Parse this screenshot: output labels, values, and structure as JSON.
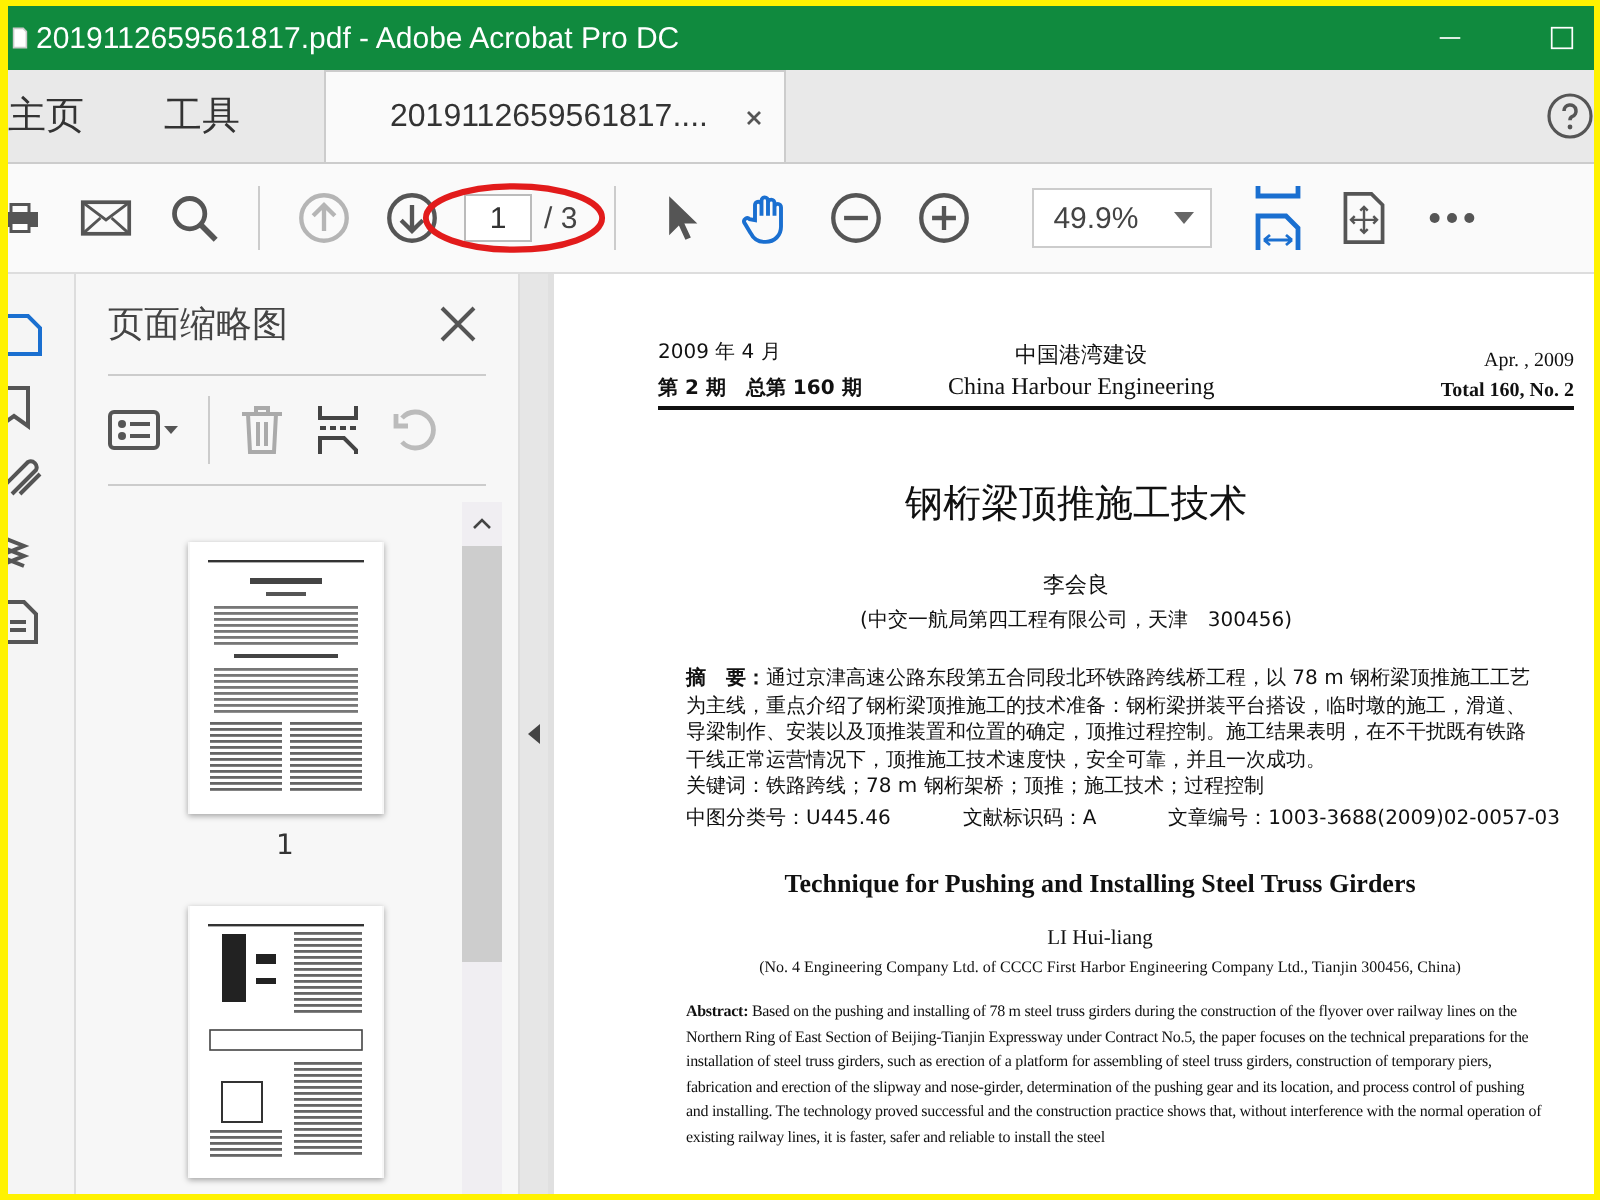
{
  "window": {
    "title": "2019112659561817.pdf - Adobe Acrobat Pro DC"
  },
  "nav_tabs": [
    {
      "label": "主页",
      "selected": false
    },
    {
      "label": "工具",
      "selected": false
    },
    {
      "label": "2019112659561817....",
      "selected": true
    }
  ],
  "toolbar": {
    "prev_page": {
      "disabled": true
    },
    "next_page": {
      "disabled": false
    },
    "page_field": {
      "value": "1",
      "total": "/ 3"
    },
    "zoom_field": {
      "value": "49.9%"
    }
  },
  "side_rail": [
    {
      "selected": true
    },
    {
      "selected": false
    },
    {
      "selected": false
    },
    {
      "selected": false
    },
    {
      "selected": false
    }
  ],
  "thumbnails_panel": {
    "title": "页面缩略图",
    "tools": {
      "delete": {
        "disabled": true
      },
      "rotate": {
        "disabled": true
      }
    },
    "thumbnails": [
      {
        "kind": "text-page",
        "label": "1"
      },
      {
        "kind": "figure-page"
      }
    ]
  },
  "document": {
    "header": {
      "date_cn": "2009 年 4 月",
      "issue_cn": "第 2 期　总第 160 期",
      "journal_cn": "中国港湾建设",
      "journal_en": "China Harbour Engineering",
      "date_en": "Apr. , 2009",
      "issue_en": "Total 160, No. 2"
    },
    "title_cn": "钢桁梁顶推施工技术",
    "author_cn": "李会良",
    "affiliation_cn": "(中交一航局第四工程有限公司，天津　300456)",
    "abstract_cn": "**摘　要：**通过京津高速公路东段第五合同段北环铁路跨线桥工程，以 78 m 钢桁梁顶推施工工艺为主线，重点介绍了钢桁梁顶推施工的技术准备：钢桁梁拼装平台搭设，临时墩的施工，滑道、导梁制作、安装以及顶推装置和位置的确定，顶推过程控制。施工结果表明，在不干扰既有铁路干线正常运营情况下，顶推施工技术速度快，安全可靠，并且一次成功。",
    "keywords_cn": "关键词：铁路跨线；78 m 钢桁架桥；顶推；施工技术；过程控制",
    "classification": [
      "中图分类号：U445.46",
      "文献标识码：A",
      "文章编号：1003-3688(2009)02-0057-03"
    ],
    "title_en": "Technique for Pushing and Installing Steel Truss Girders",
    "author_en": "LI Hui-liang",
    "affiliation_en": "(No. 4 Engineering Company Ltd. of CCCC First Harbor Engineering Company Ltd., Tianjin 300456, China)",
    "abstract_en": "**Abstract:** Based on the pushing and installing of 78 m steel truss girders during the construction of the flyover over railway lines on the Northern Ring of East Section of Beijing-Tianjin Expressway under Contract No.5, the paper focuses on the technical preparations for the installation of steel truss girders, such as erection of a platform for assembling of steel truss girders, construction of temporary piers, fabrication and erection of the slipway and nose-girder, determination of the pushing gear and its location, and process control of pushing and installing. The technology proved successful and the construction practice shows that, without interference with the normal operation of existing railway lines, it is faster, safer and reliable to install the steel"
  }
}
